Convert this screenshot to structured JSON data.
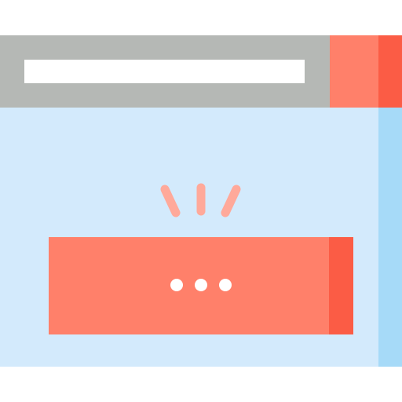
{
  "colors": {
    "title_bar": "#b5b8b5",
    "address_bar": "#ffffff",
    "close_tab": "#ff806a",
    "close_tab_edge": "#fb5c45",
    "content": "#d3eafc",
    "scroll_strip": "#a6daf8",
    "sparkle": "#ffa99a",
    "message_bar": "#ff806a",
    "message_bar_edge": "#fb5c45",
    "dots": "#ffffff"
  },
  "icons": {
    "notification": "alert-sparkle-icon",
    "more": "ellipsis-icon"
  }
}
